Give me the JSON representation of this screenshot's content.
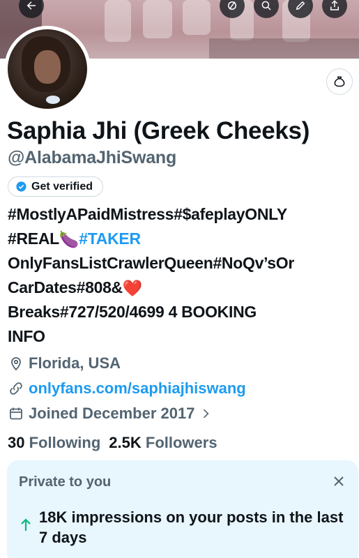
{
  "banner": {
    "top_buttons": [
      {
        "name": "back-button",
        "icon": "arrow-left-icon"
      },
      {
        "name": "grok-button",
        "icon": "slash-circle-icon"
      },
      {
        "name": "search-button",
        "icon": "search-icon"
      },
      {
        "name": "edit-button",
        "icon": "pen-icon"
      },
      {
        "name": "share-button",
        "icon": "share-icon"
      }
    ]
  },
  "profile": {
    "display_name": "Saphia Jhi (Greek Cheeks)",
    "handle": "@AlabamaJhiSwang",
    "get_verified_label": "Get verified",
    "bio": {
      "line1": "#MostlyAPaidMistress#$afeplayONLY",
      "line2_a": "#REAL",
      "line2_emoji": "🍆",
      "line2_b": "#TAKER",
      "line3": "OnlyFansListCrawlerQueen#NoQv’sOr",
      "line4_a": "CarDates#808&",
      "line4_emoji": "❤️",
      "line5": "Breaks#727/520/4699 4 BOOKING",
      "line6": "INFO"
    },
    "location": "Florida, USA",
    "website": "onlyfans.com/saphiajhiswang",
    "joined": "Joined December 2017",
    "following_count": "30",
    "following_label": "Following",
    "followers_count": "2.5K",
    "followers_label": "Followers"
  },
  "private_card": {
    "title": "Private to you",
    "message": "18K impressions on your posts in the last 7 days"
  },
  "colors": {
    "accent": "#1d9bf0",
    "secondary_text": "#536471",
    "card_bg": "#e8f6fd",
    "growth_green": "#00ba7c"
  }
}
